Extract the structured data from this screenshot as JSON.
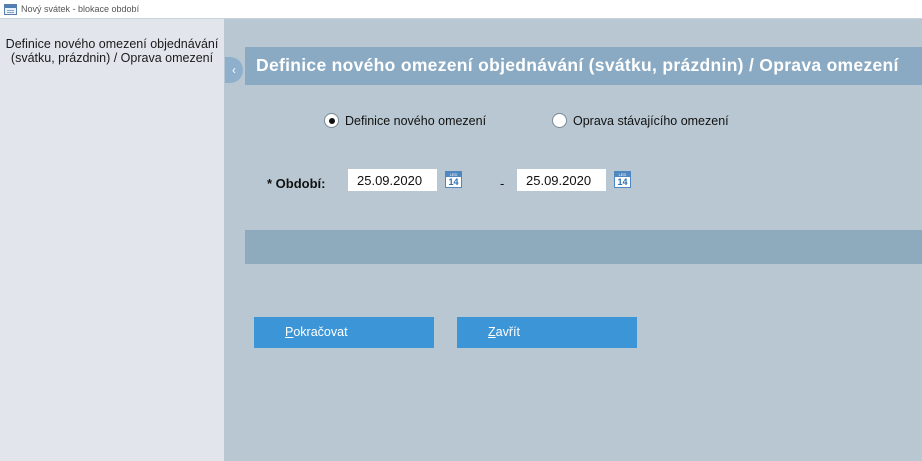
{
  "window": {
    "title": "Nový svátek - blokace období"
  },
  "sidebar": {
    "title": "Definice nového omezení objednávání (svátku, prázdnin) / Oprava omezení",
    "collapse_glyph": "‹"
  },
  "header": {
    "title": "Definice nového omezení objednávání (svátku, prázdnin) / Oprava omezení"
  },
  "mode": {
    "options": [
      {
        "label": "Definice nového omezení",
        "checked": true
      },
      {
        "label": "Oprava stávajícího omezení",
        "checked": false
      }
    ]
  },
  "period": {
    "label": "* Období:",
    "from": "25.09.2020",
    "to": "25.09.2020",
    "separator": "-",
    "calendar_icon": {
      "month": "LED",
      "day": "14"
    }
  },
  "buttons": {
    "continue": {
      "accel": "P",
      "rest": "okračovat"
    },
    "close": {
      "accel": "Z",
      "rest": "avřít"
    }
  },
  "colors": {
    "main_bg": "#b8c7d1",
    "header_bg": "#8aaac3",
    "sidebar_bg": "#e2e6ec",
    "button_bg": "#3c95d7"
  }
}
